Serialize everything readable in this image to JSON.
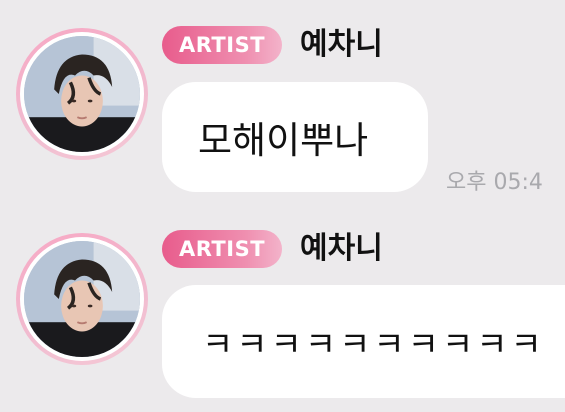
{
  "messages": [
    {
      "badge": "ARTIST",
      "sender": "예차니",
      "text": "모해이뿌나",
      "time": "오후 05:4"
    },
    {
      "badge": "ARTIST",
      "sender": "예차니",
      "text": "ㅋㅋㅋㅋㅋㅋㅋㅋㅋㅋ"
    }
  ]
}
